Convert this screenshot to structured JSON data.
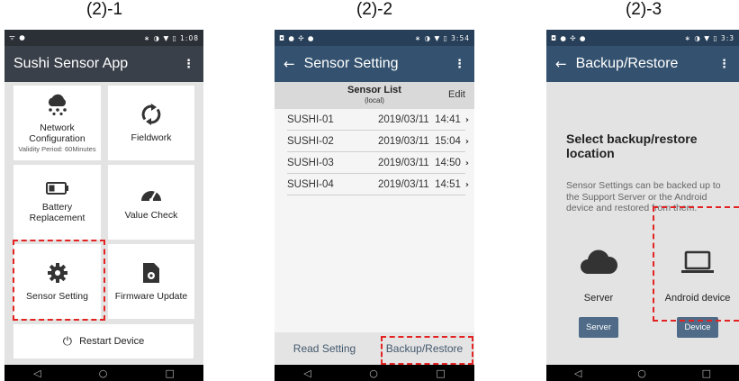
{
  "captions": [
    "(2)-1",
    "(2)-2",
    "(2)-3"
  ],
  "phone1": {
    "status_left": "ᯤ ●",
    "status_right": "∗ ◑ ▼ ▯ 1:08",
    "title": "Sushi Sensor App",
    "menu": "⋮",
    "tiles": [
      {
        "label": "Network Configuration",
        "sub": "Validity Period: 60Minutes",
        "icon": "cloud-network-icon"
      },
      {
        "label": "Fieldwork",
        "sub": "",
        "icon": "sync-icon"
      },
      {
        "label": "Battery Replacement",
        "sub": "",
        "icon": "battery-icon"
      },
      {
        "label": "Value Check",
        "sub": "",
        "icon": "gauge-icon"
      },
      {
        "label": "Sensor Setting",
        "sub": "",
        "icon": "gear-icon"
      },
      {
        "label": "Firmware Update",
        "sub": "",
        "icon": "file-gear-icon"
      }
    ],
    "restart": "Restart Device",
    "restart_icon": "⏻"
  },
  "phone2": {
    "status_left": "◘ ● ✣ ●",
    "status_right": "∗ ◑ ▼ ▯ 3:54",
    "back": "←",
    "title": "Sensor Setting",
    "menu": "⋮",
    "list_title": "Sensor List",
    "list_sub": "(local)",
    "edit": "Edit",
    "rows": [
      {
        "name": "SUSHI-01",
        "date": "2019/03/11  14:41"
      },
      {
        "name": "SUSHI-02",
        "date": "2019/03/11  15:04"
      },
      {
        "name": "SUSHI-03",
        "date": "2019/03/11  14:50"
      },
      {
        "name": "SUSHI-04",
        "date": "2019/03/11  14:51"
      }
    ],
    "read_setting": "Read Setting",
    "backup_restore": "Backup/Restore"
  },
  "phone3": {
    "status_left": "◘ ● ✣ ●",
    "status_right": "∗ ◑ ▼ ▯ 3:3",
    "back": "←",
    "title": "Backup/Restore",
    "menu": "⋮",
    "heading": "Select backup/restore location",
    "description": "Sensor Settings can be backed up to the Support Server or the Android device and restored from them.",
    "server_label": "Server",
    "server_button": "Server",
    "device_label": "Android device",
    "device_button": "Device"
  },
  "nav": {
    "back": "◁",
    "home": "○",
    "recents": "□"
  },
  "colors": {
    "highlight": "#e32222",
    "appbar1": "#3a404a",
    "appbar2": "#34526f",
    "button": "#4f6b87"
  }
}
